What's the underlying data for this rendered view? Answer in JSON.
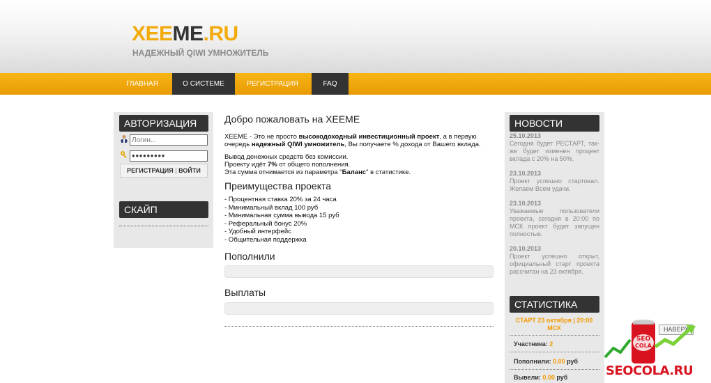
{
  "site": {
    "logo_part1": "XEE",
    "logo_part2": "ME",
    "logo_part3": ".RU",
    "tagline": "НАДЕЖНЫЙ QIWI УМНОЖИТЕЛЬ"
  },
  "nav": [
    {
      "label": "ГЛАВНАЯ",
      "active": false
    },
    {
      "label": "О СИСТЕМЕ",
      "active": true
    },
    {
      "label": "РЕГИСТРАЦИЯ",
      "active": false
    },
    {
      "label": "FAQ",
      "active": true
    }
  ],
  "auth": {
    "title": "АВТОРИЗАЦИЯ",
    "login_placeholder": "Логин...",
    "password_value": "●●●●●●●●●",
    "register_label": "РЕГИСТРАЦИЯ",
    "separator": "|",
    "login_label": "ВОЙТИ"
  },
  "skype": {
    "title": "СКАЙП"
  },
  "main": {
    "welcome": "Добро пожаловать на XEEME",
    "intro_1": "XEEME - Это не просто ",
    "intro_bold_1": "высокодоходный инвестиционный проект",
    "intro_2": ", а в первую очередь ",
    "intro_bold_2": "надежный QIWI умножитель",
    "intro_3": ", Вы получаете % дохода от Вашего вклада.",
    "line_1": "Вывод денежных средств без комиссии.",
    "line_2a": "Проекту идёт ",
    "line_2b": "7%",
    "line_2c": " от общего пополнения.",
    "line_3a": "Эта сумма отнимается из параметра \"",
    "line_3b": "Баланс",
    "line_3c": "\" в статистике.",
    "advantages_title": "Преимущества проекта",
    "advantages": [
      "- Процентная ставка 20% за 24 часа",
      "- Минимальный вклад 100 руб",
      "- Минимальная сумма вывода 15 руб",
      "- Реферальный бонус 20%",
      "- Удобный интерфейс",
      "- Общительная поддержка"
    ],
    "deposits_title": "Пополнили",
    "payouts_title": "Выплаты"
  },
  "news": {
    "title": "НОВОСТИ",
    "items": [
      {
        "date": "25.10.2013",
        "text": "Сегодня будет РЕСТАРТ, так-же будет изменен процент вклада с 20% на 50%."
      },
      {
        "date": "23.10.2013",
        "text": "Проект успешно стартовал. Желаем Всем удачи."
      },
      {
        "date": "23.10.2013",
        "text": "Уважаемые пользователи проекта, сегодня в 20:00 по МСК проект будет запущен полностью."
      },
      {
        "date": "20.10.2013",
        "text": "Проект успешно открыт, официальный старт проекта рассчитан на 23 октября."
      }
    ]
  },
  "stats": {
    "title": "СТАТИСТИКА",
    "start": "СТАРТ 23 октября | 20:00 МСК",
    "participants_label": "Участника: ",
    "participants_value": "2",
    "deposited_label": "Пополнили: ",
    "deposited_value": "0.00",
    "deposited_unit": " руб",
    "withdrawn_label": "Вывели: ",
    "withdrawn_value": "0.00",
    "withdrawn_unit": " руб"
  },
  "up_button": "НАВЕРХ",
  "watermark": "SEOCOLA.RU",
  "colors": {
    "accent": "#f3ab0c",
    "dark": "#333333",
    "orange_text": "#f39a00"
  }
}
